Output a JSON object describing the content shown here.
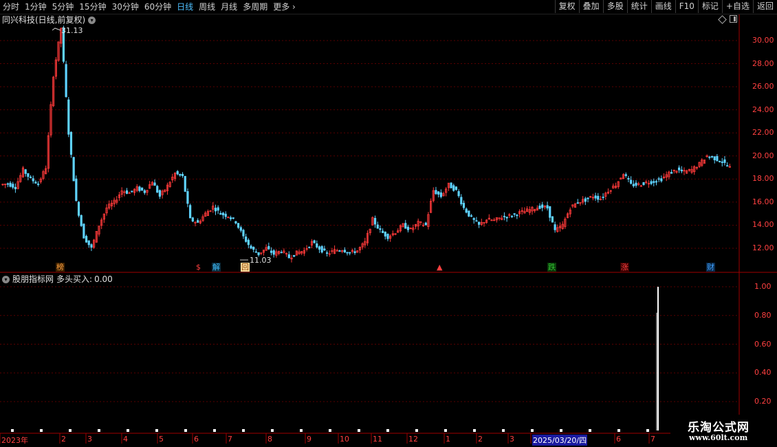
{
  "toolbar": {
    "tabs": [
      "分时",
      "1分钟",
      "5分钟",
      "15分钟",
      "30分钟",
      "60分钟",
      "日线",
      "周线",
      "月线",
      "多周期",
      "更多"
    ],
    "active_tab": "日线",
    "right_buttons": [
      "复权",
      "叠加",
      "多股",
      "统计",
      "画线",
      "F10",
      "标记",
      "+自选",
      "返回"
    ]
  },
  "main_panel": {
    "title": "同兴科技(日线,前复权)",
    "high_label": "31.13",
    "low_label": "11.03",
    "y_ticks": [
      "30.00",
      "28.00",
      "26.00",
      "24.00",
      "22.00",
      "20.00",
      "18.00",
      "16.00",
      "14.00",
      "12.00"
    ],
    "markers": [
      {
        "text": "榜",
        "color": "#ffa040"
      },
      {
        "text": "$",
        "color": "#ff4040"
      },
      {
        "text": "解",
        "color": "#40c0ff"
      },
      {
        "text": "回",
        "color": "#ffd070"
      },
      {
        "text": "▲",
        "color": "#ff4040"
      },
      {
        "text": "跌",
        "color": "#30c030"
      },
      {
        "text": "涨",
        "color": "#ff4040"
      },
      {
        "text": "财",
        "color": "#40a0ff"
      }
    ]
  },
  "indicator_panel": {
    "title": "股朋指标网",
    "series_label": "多头买入:",
    "series_value": "0.00",
    "y_ticks": [
      "1.00",
      "0.80",
      "0.60",
      "0.40",
      "0.20"
    ]
  },
  "x_axis": {
    "labels": [
      "2023年",
      "2",
      "3",
      "4",
      "5",
      "6",
      "7",
      "8",
      "9",
      "10",
      "11",
      "12",
      "1",
      "2",
      "3",
      "2025/03/20/四",
      "6",
      "7"
    ],
    "highlight": "2025/03/20/四"
  },
  "watermark": {
    "line1": "乐淘公式网",
    "line2": "www.60lt.com"
  },
  "chart_data": {
    "type": "candlestick",
    "title": "同兴科技(日线,前复权)",
    "price_range": [
      11,
      31
    ],
    "high": 31.13,
    "low": 11.03,
    "close_path": [
      17.5,
      17.6,
      17.3,
      18.8,
      18.0,
      17.6,
      19.0,
      27.0,
      31.1,
      22.0,
      16.0,
      13.0,
      12.0,
      14.0,
      15.5,
      16.0,
      17.0,
      16.8,
      17.2,
      16.9,
      17.8,
      16.5,
      17.4,
      18.5,
      18.2,
      14.5,
      14.2,
      15.0,
      15.6,
      15.0,
      14.8,
      14.3,
      13.0,
      12.0,
      11.5,
      12.0,
      11.5,
      11.8,
      11.2,
      11.6,
      11.8,
      12.5,
      12.0,
      11.5,
      11.8,
      11.9,
      11.6,
      11.8,
      12.5,
      14.5,
      13.5,
      13.0,
      13.4,
      14.0,
      13.6,
      14.2,
      14.0,
      17.0,
      16.5,
      17.5,
      17.0,
      15.5,
      14.6,
      14.0,
      14.5,
      14.4,
      14.7,
      14.8,
      15.0,
      15.2,
      15.4,
      15.6,
      15.5,
      13.5,
      14.0,
      15.5,
      16.0,
      16.2,
      16.5,
      16.3,
      17.0,
      17.5,
      18.5,
      17.5,
      17.5,
      17.7,
      17.8,
      18.0,
      18.5,
      18.8,
      18.6,
      18.8,
      19.3,
      20.0,
      19.8,
      19.5,
      19.0
    ],
    "indicator": {
      "name": "多头买入",
      "range": [
        0,
        1
      ],
      "values": [
        0,
        0,
        0,
        0,
        0,
        0,
        0,
        0,
        0,
        0,
        0,
        0,
        0,
        0,
        0,
        0,
        0,
        0,
        0,
        0,
        0,
        0,
        0,
        0,
        0,
        0,
        0,
        0,
        0,
        0,
        0,
        0,
        0,
        0,
        0,
        0,
        0,
        0,
        0,
        0,
        0,
        0,
        0,
        0,
        0,
        0,
        0,
        0,
        0,
        0,
        0,
        0,
        0,
        0,
        0,
        0,
        0,
        0,
        0,
        0,
        0,
        0,
        0,
        0,
        0,
        0,
        0,
        0,
        0,
        0,
        0,
        0,
        0,
        0,
        0,
        0,
        0,
        0,
        0,
        0,
        0,
        0,
        0,
        0,
        0,
        0,
        0,
        0,
        0,
        0,
        0,
        0,
        1,
        0,
        0,
        0,
        0
      ]
    }
  }
}
